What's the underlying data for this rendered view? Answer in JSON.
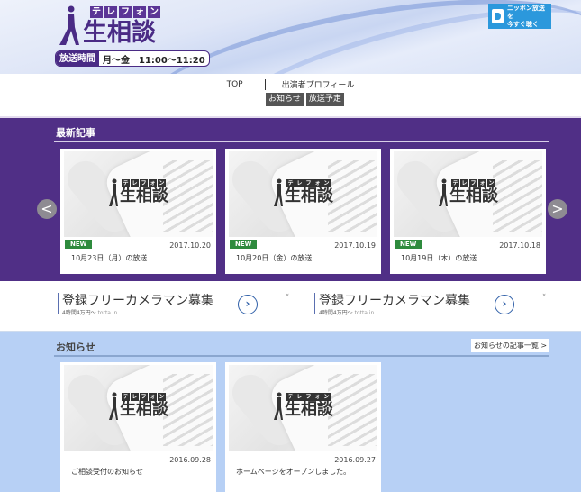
{
  "header": {
    "logo_kana": [
      "テ",
      "レ",
      "フ",
      "ォ",
      "ン"
    ],
    "logo_kanji": "生相談",
    "airtime_label": "放送時間",
    "airtime_value": "月〜金　11:00〜11:20",
    "radio_button_line1": "ニッポン放送を",
    "radio_button_line2": "今すぐ聴く"
  },
  "nav": {
    "links": [
      {
        "label": "TOP"
      },
      {
        "label": "出演者プロフィール"
      }
    ],
    "buttons": [
      {
        "label": "お知らせ"
      },
      {
        "label": "放送予定"
      }
    ]
  },
  "latest": {
    "title": "最新記事",
    "prev_icon": "<",
    "next_icon": ">",
    "cards": [
      {
        "badge": "NEW",
        "date": "2017.10.20",
        "title": "10月23日（月）の放送"
      },
      {
        "badge": "NEW",
        "date": "2017.10.19",
        "title": "10月20日（金）の放送"
      },
      {
        "badge": "NEW",
        "date": "2017.10.18",
        "title": "10月19日（木）の放送"
      }
    ],
    "thumb_logo_kana": [
      "テ",
      "レ",
      "フ",
      "ォ",
      "ン"
    ],
    "thumb_logo_kanji": "生相談"
  },
  "ads": [
    {
      "title": "登録フリーカメラマン募集",
      "sub": "4時間4万円〜",
      "domain": "totta.in",
      "go_icon": "›",
      "close_icon": "✕"
    },
    {
      "title": "登録フリーカメラマン募集",
      "sub": "4時間4万円〜",
      "domain": "totta.in",
      "go_icon": "›",
      "close_icon": "✕"
    }
  ],
  "notices": {
    "title": "お知らせ",
    "more_label": "お知らせの記事一覧 >",
    "cards": [
      {
        "date": "2016.09.28",
        "title": "ご相談受付のお知らせ"
      },
      {
        "date": "2016.09.27",
        "title": "ホームページをオープンしました。"
      }
    ]
  },
  "colors": {
    "brand_purple": "#502f86",
    "new_badge_green": "#2e8b3d",
    "notice_bg": "#b7d0f5",
    "radio_blue": "#2b98dc"
  }
}
